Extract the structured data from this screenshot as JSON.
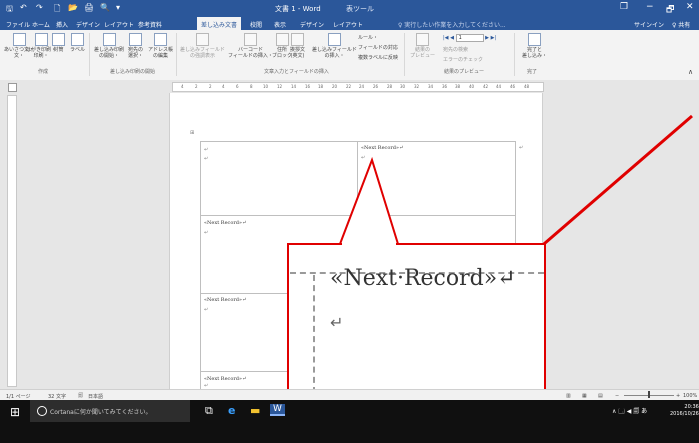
{
  "titlebar": {
    "title": "文書 1 - Word",
    "context_tab": "表ツール",
    "qa_save": "🖫",
    "qa_undo": "↶",
    "qa_redo": "↷",
    "qa_new": "🗋",
    "qa_open": "📂",
    "qa_print": "🖨",
    "qa_preview": "🔍",
    "qa_more": "▾",
    "restore": "❐",
    "minimize": "−",
    "maximize": "🗗",
    "close": "✕"
  },
  "tabs": [
    "ファイル",
    "ホーム",
    "挿入",
    "デザイン",
    "レイアウト",
    "参考資料",
    "差し込み文書",
    "校閲",
    "表示",
    "デザイン",
    "レイアウト"
  ],
  "active_tab_index": 6,
  "tellme": "♀ 実行したい作業を入力してください...",
  "signin": "サインイン",
  "share": "♀ 共有",
  "ribbon": {
    "create": {
      "buttons": [
        "あいさつ文・",
        "はがき印刷・",
        "封筒",
        "ラベル"
      ],
      "buttons2": [
        "文・",
        "印刷・",
        "",
        ""
      ],
      "label": "作成"
    },
    "start": {
      "buttons": [
        "差し込み印刷",
        "宛先の",
        "アドレス帳"
      ],
      "buttons2": [
        "の開始・",
        "選択・",
        "の編集"
      ],
      "label": "差し込み印刷の開始"
    },
    "insert": {
      "buttons": [
        "差し込みフィールド",
        "バーコード",
        "住所",
        "挨拶文",
        "差し込みフィールド"
      ],
      "buttons2": [
        "の強調表示",
        "フィールドの挿入・",
        "ブロック",
        "(英文)",
        "の挿入・"
      ],
      "small": [
        "ルール・",
        "フィールドの対応",
        "複数ラベルに反映"
      ],
      "label": "文章入力とフィールドの挿入"
    },
    "preview": {
      "button": "結果の",
      "button2": "プレビュー",
      "record": "1",
      "small": [
        "宛先の検索",
        "エラーのチェック"
      ],
      "label": "結果のプレビュー"
    },
    "finish": {
      "button": "完了と",
      "button2": "差し込み・",
      "label": "完了"
    }
  },
  "ruler_ticks": [
    "4",
    "2",
    "2",
    "4",
    "6",
    "8",
    "10",
    "12",
    "14",
    "16",
    "18",
    "20",
    "22",
    "24",
    "26",
    "28",
    "30",
    "32",
    "34",
    "36",
    "38",
    "40",
    "42",
    "44",
    "46",
    "48"
  ],
  "document": {
    "table_handle": "⊞",
    "records": [
      "«Next Record»↵",
      "«Next Record»↵",
      "«Next Record»↵",
      "«Next Record»↵"
    ],
    "return_mark": "↵"
  },
  "callout": {
    "text": "«Next·Record»↵",
    "return_mark": "↵"
  },
  "statusbar": {
    "page": "1/1 ページ",
    "words": "32 文字",
    "lang_icon": "🗐",
    "lang": "日本語",
    "zoom": "100%",
    "zoom_minus": "−",
    "zoom_plus": "+"
  },
  "taskbar": {
    "search_placeholder": "Cortanaに何か聞いてみてください。",
    "start_icon": "⊞",
    "taskview_icon": "⧉",
    "edge_icon": "e",
    "explorer_icon": "▬",
    "word_icon": "W",
    "tray": "∧ 🗔 ◀ 🗐 あ",
    "time": "20:36",
    "date": "2016/10/26"
  }
}
